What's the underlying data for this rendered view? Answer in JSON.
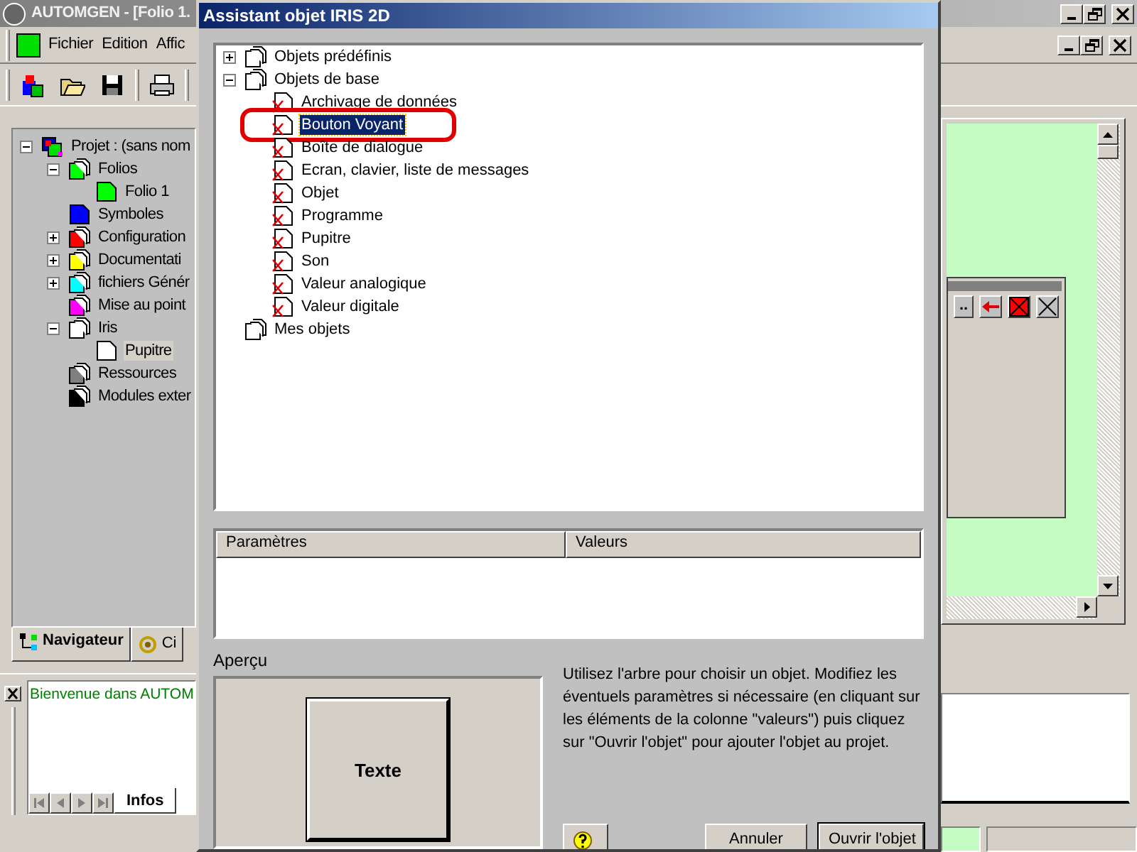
{
  "app": {
    "title": "AUTOMGEN - [Folio 1.",
    "menu": [
      "Fichier",
      "Edition",
      "Affic"
    ],
    "project_tree": [
      {
        "label": "Projet : (sans nom",
        "kind": "project",
        "expanded": true,
        "selected": false,
        "children": [
          {
            "label": "Folios",
            "kind": "group",
            "color": "#00ff00",
            "expanded": true,
            "selected": false,
            "children": [
              {
                "label": "Folio 1",
                "kind": "page",
                "color": "#00ff00",
                "selected": false
              }
            ]
          },
          {
            "label": "Symboles",
            "kind": "page",
            "color": "#0000ff",
            "selected": false
          },
          {
            "label": "Configuration",
            "kind": "group",
            "color": "#ff0000",
            "expanded": false,
            "selected": false
          },
          {
            "label": "Documentati",
            "kind": "group",
            "color": "#ffff00",
            "expanded": false,
            "selected": false
          },
          {
            "label": "fichiers Génér",
            "kind": "group",
            "color": "#00ffff",
            "expanded": false,
            "selected": false
          },
          {
            "label": "Mise au point",
            "kind": "group",
            "color": "#ff00ff",
            "selected": false
          },
          {
            "label": "Iris",
            "kind": "group",
            "color": "#ffffff",
            "expanded": true,
            "selected": false,
            "children": [
              {
                "label": "Pupitre",
                "kind": "page",
                "color": "#ffffff",
                "selected": true
              }
            ]
          },
          {
            "label": "Ressources",
            "kind": "group",
            "color": "#808080",
            "selected": false
          },
          {
            "label": "Modules exter",
            "kind": "group",
            "color": "#000000",
            "selected": false
          }
        ]
      }
    ],
    "pane_tabs": [
      {
        "label": "Navigateur",
        "selected": true
      },
      {
        "label": "Ci",
        "selected": false
      }
    ],
    "message": "Bienvenue dans AUTOM",
    "bottom_tabs": [
      {
        "label": "Infos",
        "selected": true
      }
    ],
    "floating_toolbar": [
      {
        "kind": "text",
        "label": ".."
      },
      {
        "kind": "arrow"
      },
      {
        "kind": "delete"
      },
      {
        "kind": "close"
      }
    ]
  },
  "dialog": {
    "title": "Assistant objet IRIS 2D",
    "tree": [
      {
        "label": "Objets prédéfinis",
        "kind": "group",
        "expanded": false,
        "selected": false,
        "circled": false
      },
      {
        "label": "Objets de base",
        "kind": "group",
        "expanded": true,
        "selected": false,
        "circled": false,
        "children": [
          {
            "label": "Archivage de données",
            "kind": "object",
            "selected": false,
            "circled": false
          },
          {
            "label": "Bouton Voyant",
            "kind": "object",
            "selected": true,
            "circled": true
          },
          {
            "label": "Boîte de dialogue",
            "kind": "object",
            "selected": false,
            "circled": false
          },
          {
            "label": "Ecran, clavier, liste de messages",
            "kind": "object",
            "selected": false,
            "circled": false
          },
          {
            "label": "Objet",
            "kind": "object",
            "selected": false,
            "circled": false
          },
          {
            "label": "Programme",
            "kind": "object",
            "selected": false,
            "circled": false
          },
          {
            "label": "Pupitre",
            "kind": "object",
            "selected": false,
            "circled": false
          },
          {
            "label": "Son",
            "kind": "object",
            "selected": false,
            "circled": false
          },
          {
            "label": "Valeur analogique",
            "kind": "object",
            "selected": false,
            "circled": false
          },
          {
            "label": "Valeur digitale",
            "kind": "object",
            "selected": false,
            "circled": false
          }
        ]
      },
      {
        "label": "Mes objets",
        "kind": "group",
        "selected": false,
        "circled": false
      }
    ],
    "params_table": {
      "columns": [
        "Paramètres",
        "Valeurs"
      ]
    },
    "preview_label": "Aperçu",
    "preview_text": "Texte",
    "help_text": "Utilisez l'arbre pour choisir un objet. Modifiez les éventuels paramètres si nécessaire (en cliquant sur les éléments de la colonne \"valeurs\") puis cliquez sur \"Ouvrir l'objet\" pour ajouter l'objet au projet.",
    "buttons": [
      {
        "label": "Annuler",
        "default": false
      },
      {
        "label": "Ouvrir l'objet",
        "default": true
      }
    ]
  }
}
